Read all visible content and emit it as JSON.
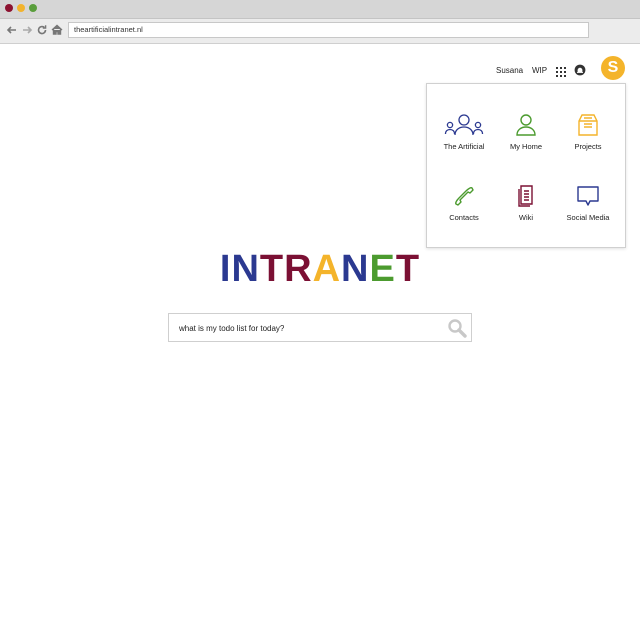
{
  "browser": {
    "url": "theartificialintranet.nl"
  },
  "header": {
    "user_name": "Susana",
    "wip_label": "WIP",
    "avatar_initial": "S",
    "icons": {
      "apps": "apps-grid-icon",
      "notifications": "notification-icon"
    }
  },
  "apps_menu": {
    "items": [
      {
        "label": "The Artificial",
        "icon": "people-group-icon",
        "color": "#2b3990"
      },
      {
        "label": "My Home",
        "icon": "person-icon",
        "color": "#4c9b2f"
      },
      {
        "label": "Projects",
        "icon": "folder-box-icon",
        "color": "#f4b42b"
      },
      {
        "label": "Contacts",
        "icon": "phone-icon",
        "color": "#4c9b2f"
      },
      {
        "label": "Wiki",
        "icon": "document-icon",
        "color": "#7b1034"
      },
      {
        "label": "Social Media",
        "icon": "speech-bubble-icon",
        "color": "#2b3990"
      }
    ]
  },
  "logo": {
    "letters": [
      {
        "char": "I",
        "color": "#2b3990"
      },
      {
        "char": "N",
        "color": "#2b3990"
      },
      {
        "char": "T",
        "color": "#7b1034"
      },
      {
        "char": "R",
        "color": "#7b1034"
      },
      {
        "char": "A",
        "color": "#f4b42b"
      },
      {
        "char": "N",
        "color": "#2b3990"
      },
      {
        "char": "E",
        "color": "#4c9b2f"
      },
      {
        "char": "T",
        "color": "#7b1034"
      }
    ]
  },
  "search": {
    "value": "what is my todo list for today?"
  },
  "colors": {
    "accent_yellow": "#f4b42b",
    "navy": "#2b3990",
    "maroon": "#7b1034",
    "green": "#4c9b2f"
  }
}
